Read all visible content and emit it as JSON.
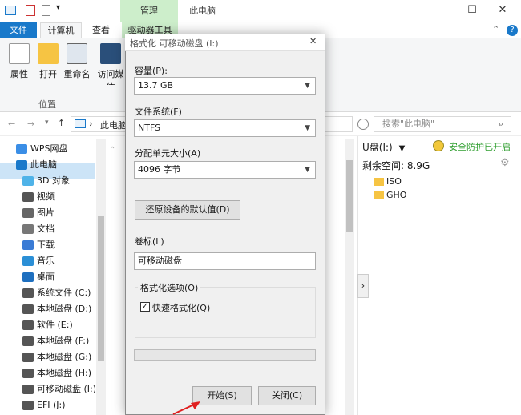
{
  "window": {
    "title": "此电脑",
    "manage_tab": "管理",
    "controls": {
      "minimize": "—",
      "maximize": "☐",
      "close": "✕"
    }
  },
  "ribbon": {
    "tabs": {
      "file": "文件",
      "computer": "计算机",
      "view": "查看",
      "drive_tools": "驱动器工具"
    },
    "buttons": {
      "properties": "属性",
      "open": "打开",
      "rename": "重命名",
      "access_media": "访问媒体"
    },
    "group_location": "位置",
    "collapse_glyph": "⌃",
    "help_glyph": "?"
  },
  "address": {
    "path": "此电脑",
    "search_placeholder": "搜索\"此电脑\""
  },
  "nav_pane": {
    "items": [
      {
        "label": "WPS网盘"
      },
      {
        "label": "此电脑"
      },
      {
        "label": "3D 对象"
      },
      {
        "label": "视频"
      },
      {
        "label": "图片"
      },
      {
        "label": "文档"
      },
      {
        "label": "下载"
      },
      {
        "label": "音乐"
      },
      {
        "label": "桌面"
      },
      {
        "label": "系统文件 (C:)"
      },
      {
        "label": "本地磁盘 (D:)"
      },
      {
        "label": "软件 (E:)"
      },
      {
        "label": "本地磁盘 (F:)"
      },
      {
        "label": "本地磁盘 (G:)"
      },
      {
        "label": "本地磁盘 (H:)"
      },
      {
        "label": "可移动磁盘 (I:)"
      },
      {
        "label": "EFI (J:)"
      }
    ]
  },
  "right_pane": {
    "drive_label": "U盘(I:)",
    "security_text": "安全防护已开启",
    "free_space": "剩余空间: 8.9G",
    "folders": [
      "ISO",
      "GHO"
    ]
  },
  "dialog": {
    "title": "格式化 可移动磁盘 (I:)",
    "capacity_label": "容量(P):",
    "capacity_value": "13.7 GB",
    "filesystem_label": "文件系统(F)",
    "filesystem_value": "NTFS",
    "alloc_label": "分配单元大小(A)",
    "alloc_value": "4096 字节",
    "restore_button": "还原设备的默认值(D)",
    "volume_label": "卷标(L)",
    "volume_value": "可移动磁盘",
    "options_legend": "格式化选项(O)",
    "quick_format_label": "快速格式化(Q)",
    "quick_format_checked": true,
    "progress": 0,
    "start_button": "开始(S)",
    "close_button": "关闭(C)"
  },
  "colors": {
    "file_tab": "#1979ca",
    "drive_tab": "#cdeecb",
    "selection": "#cce4f7",
    "security_green": "#2e9e2e",
    "annotation_arrow": "#e02020"
  }
}
